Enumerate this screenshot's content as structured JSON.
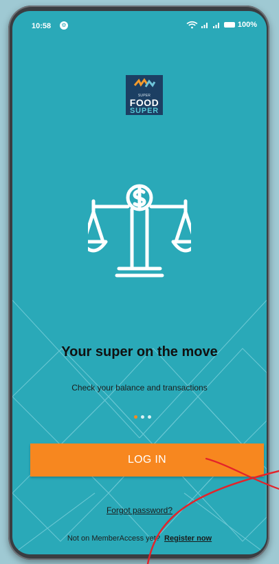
{
  "status_bar": {
    "time": "10:58",
    "notification_badge": "⚙",
    "battery": "100%",
    "signal_icons": [
      "wifi-icon",
      "signal-icon",
      "signal-icon"
    ]
  },
  "logo": {
    "top_text": "SUPER",
    "food_text": "FOOD",
    "super_text": "SUPER",
    "brand_navy": "#1c3f63",
    "brand_teal": "#56c8d7"
  },
  "hero": {
    "icon": "scale-dollar-icon",
    "title": "Your super on the move",
    "subtitle": "Check your balance and transactions"
  },
  "pager": {
    "count": 3,
    "active_index": 0
  },
  "actions": {
    "login_label": "LOG IN",
    "forgot_label": "Forgot password?",
    "register_prompt": "Not on MemberAccess yet?",
    "register_label": "Register now"
  },
  "colors": {
    "background": "#2aa9b8",
    "button": "#f7871f",
    "text_dark": "#111111",
    "annotation": "#e3232a"
  }
}
